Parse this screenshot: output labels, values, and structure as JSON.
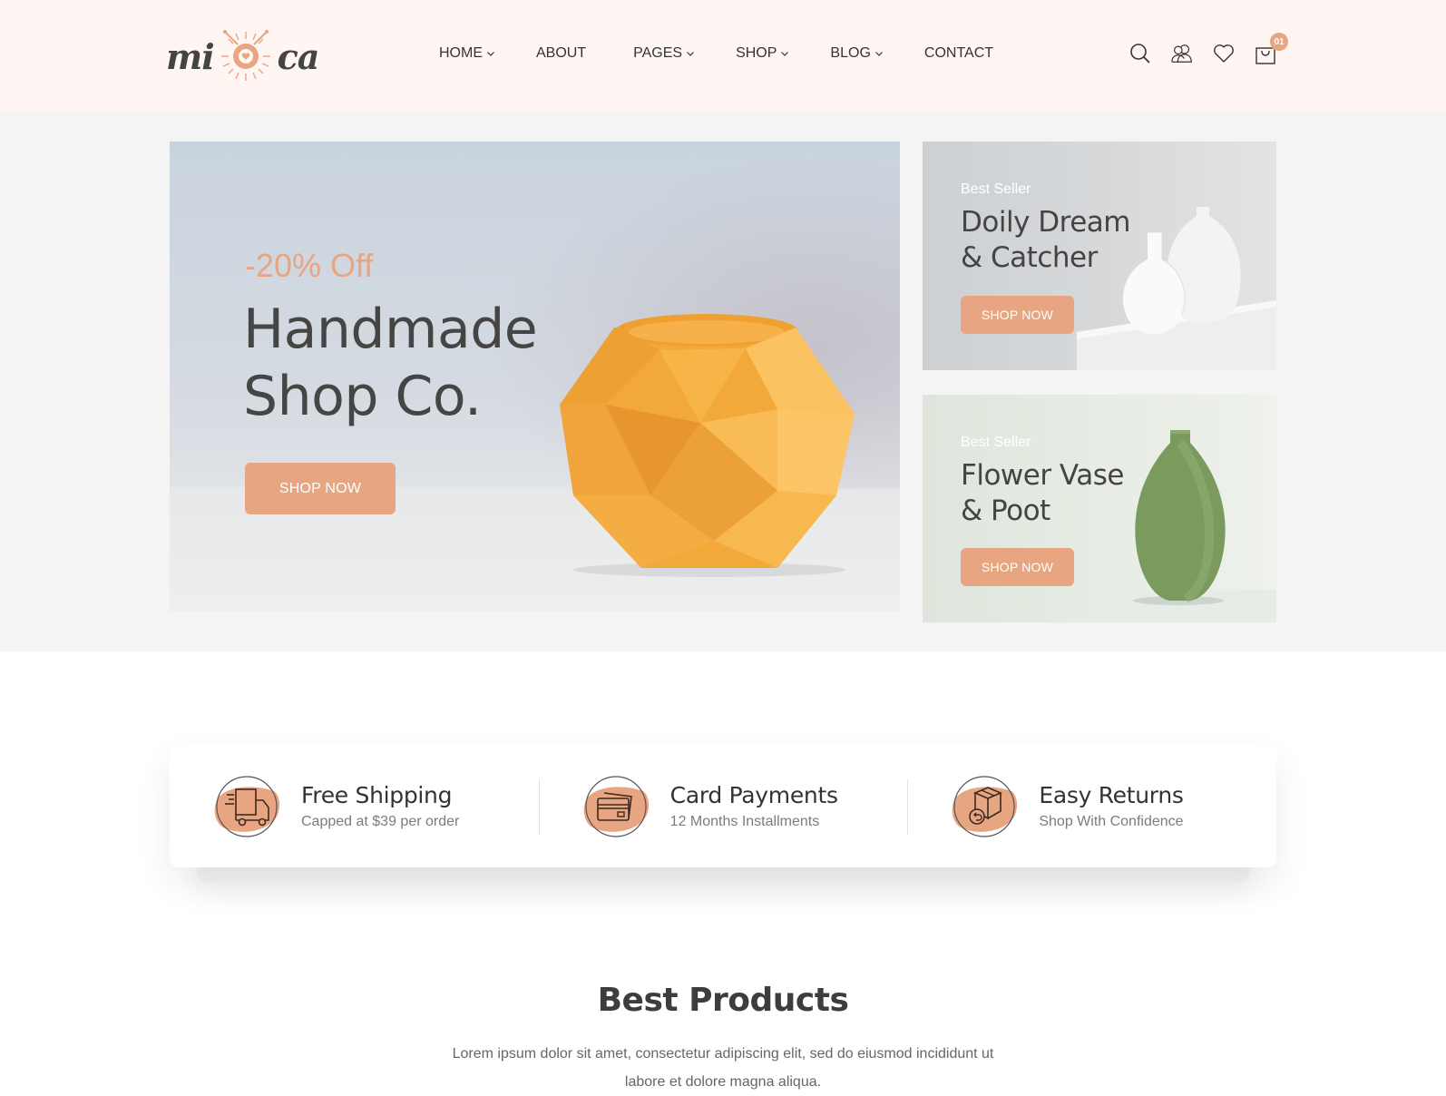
{
  "brand": {
    "left": "mi",
    "right": "ca",
    "accent_color": "#e8a582"
  },
  "nav": {
    "items": [
      {
        "label": "HOME",
        "has_dropdown": true
      },
      {
        "label": "ABOUT",
        "has_dropdown": false
      },
      {
        "label": "PAGES",
        "has_dropdown": true
      },
      {
        "label": "SHOP",
        "has_dropdown": true
      },
      {
        "label": "BLOG",
        "has_dropdown": true
      },
      {
        "label": "CONTACT",
        "has_dropdown": false
      }
    ]
  },
  "header_icons": {
    "search": "search-icon",
    "account": "users-icon",
    "wishlist": "heart-icon",
    "cart": "shopping-bag-icon",
    "cart_count": "01"
  },
  "hero": {
    "discount": "-20% Off",
    "title_line1": "Handmade",
    "title_line2": "Shop Co.",
    "button": "SHOP NOW"
  },
  "side_cards": [
    {
      "subtitle": "Best Seller",
      "title_line1": "Doily Dream",
      "title_line2": "& Catcher",
      "button": "SHOP NOW"
    },
    {
      "subtitle": "Best Seller",
      "title_line1": "Flower Vase",
      "title_line2": "& Poot",
      "button": "SHOP NOW"
    }
  ],
  "features": [
    {
      "icon": "truck-icon",
      "title": "Free Shipping",
      "subtitle": "Capped at $39 per order"
    },
    {
      "icon": "credit-card-icon",
      "title": "Card Payments",
      "subtitle": "12 Months Installments"
    },
    {
      "icon": "return-box-icon",
      "title": "Easy Returns",
      "subtitle": "Shop With Confidence"
    }
  ],
  "best_products": {
    "title": "Best Products",
    "description": "Lorem ipsum dolor sit amet, consectetur adipiscing elit, sed do eiusmod incididunt ut labore et dolore magna aliqua."
  }
}
